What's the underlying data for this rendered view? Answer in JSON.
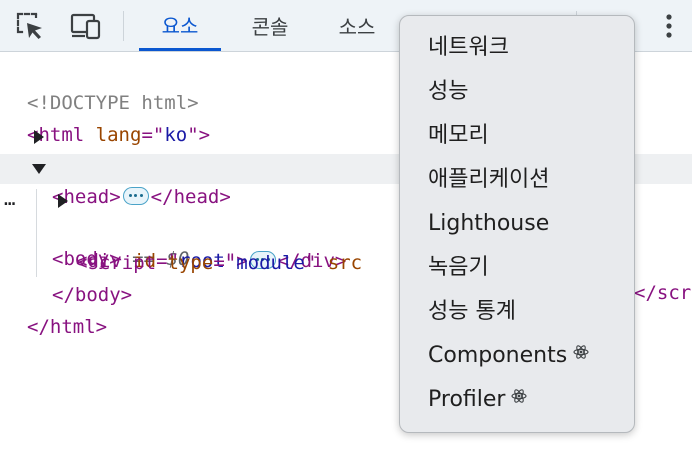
{
  "toolbar": {
    "icons": [
      "inspect-element-icon",
      "device-toggle-icon",
      "more-vert-icon"
    ],
    "tabs": [
      {
        "label": "요소",
        "active": true
      },
      {
        "label": "콘솔",
        "active": false
      },
      {
        "label": "소스",
        "active": false
      }
    ]
  },
  "tree": {
    "doctype": "<!DOCTYPE html>",
    "html_open": {
      "tag": "html",
      "attr": "lang",
      "value": "ko"
    },
    "head": {
      "open": "head",
      "close": "/head"
    },
    "body": {
      "open": "body",
      "eq": " == ",
      "var": "$0",
      "gutter": "…"
    },
    "div": {
      "tag": "div",
      "attr": "id",
      "value": "root",
      "close": "/div"
    },
    "script": {
      "tag": "script",
      "attr1": "type",
      "value1": "module",
      "attr2_fragment": "src",
      "trailing": "</scr"
    },
    "body_close": "</body>",
    "html_close": "</html>"
  },
  "menu": {
    "items": [
      {
        "label": "네트워크",
        "react": false
      },
      {
        "label": "성능",
        "react": false
      },
      {
        "label": "메모리",
        "react": false
      },
      {
        "label": "애플리케이션",
        "react": false
      },
      {
        "label": "Lighthouse",
        "react": false
      },
      {
        "label": "녹음기",
        "react": false
      },
      {
        "label": "성능 통계",
        "react": false
      },
      {
        "label": "Components",
        "react": true
      },
      {
        "label": "Profiler",
        "react": true
      }
    ]
  },
  "colors": {
    "active_tab": "#0b57d0",
    "tag": "#881280",
    "attr": "#994500",
    "value": "#1a1aa6"
  }
}
